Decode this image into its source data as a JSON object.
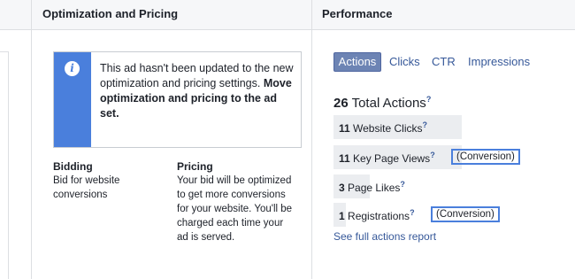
{
  "columns": {
    "optimization_title": "Optimization and Pricing",
    "performance_title": "Performance"
  },
  "notice": {
    "icon": "info-icon",
    "text_plain": "This ad hasn't been updated to the new optimization and pricing settings.",
    "text_bold": "Move optimization and pricing to the ad set."
  },
  "bidding": {
    "label": "Bidding",
    "text": "Bid for website conversions"
  },
  "pricing": {
    "label": "Pricing",
    "text": "Your bid will be optimized to get more conversions for your website. You'll be charged each time your ad is served."
  },
  "tabs": {
    "actions": "Actions",
    "clicks": "Clicks",
    "ctr": "CTR",
    "impressions": "Impressions"
  },
  "total": {
    "count": "26",
    "label": "Total Actions",
    "help": "?"
  },
  "actions": [
    {
      "count": "11",
      "label": "Website Clicks",
      "help": "?",
      "share": 0.42,
      "conversion": ""
    },
    {
      "count": "11",
      "label": "Key Page Views",
      "help": "?",
      "share": 0.42,
      "conversion": "(Conversion)"
    },
    {
      "count": "3",
      "label": "Page Likes",
      "help": "?",
      "share": 0.12,
      "conversion": ""
    },
    {
      "count": "1",
      "label": "Registrations",
      "help": "?",
      "share": 0.04,
      "conversion": "(Conversion)"
    }
  ],
  "link": "See full actions report",
  "colors": {
    "accent": "#4a7fdc",
    "link": "#365899",
    "active_tab": "#6d84b4",
    "bar": "#ebedf0"
  }
}
